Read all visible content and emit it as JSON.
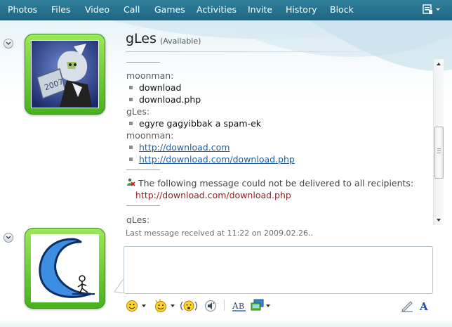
{
  "menu": {
    "items": [
      "Photos",
      "Files",
      "Video",
      "Call",
      "Games",
      "Activities",
      "Invite",
      "History",
      "Block"
    ]
  },
  "contact": {
    "name": "gLes",
    "status": "(Available)"
  },
  "conversation": {
    "messages": [
      {
        "sender": "moonman:",
        "lines": [
          "download",
          "download.php"
        ]
      },
      {
        "sender": "gLes:",
        "lines": [
          "egyre gagyibbak a spam-ek"
        ]
      },
      {
        "sender": "moonman:",
        "links": [
          "http://download.com",
          "http://download.com/download.php"
        ]
      }
    ],
    "error": {
      "text": "The following message could not be delivered to all recipients:",
      "url": "http://download.com/download.php"
    },
    "last_sender": "gLes:"
  },
  "last_message": "Last message received at 11:22 on 2009.02.26..",
  "icons": {
    "menu_more": "window-menu-icon",
    "error": "red-x-person-icon",
    "emoticon": "smiley-icon",
    "wink": "wink-icon",
    "nudge": "nudge-icon",
    "voice_clip": "voice-clip-icon",
    "font": "font-icon",
    "backgrounds": "backgrounds-icon",
    "handwriting": "handwriting-icon",
    "text_style": "text-style-icon"
  },
  "colors": {
    "menubar": "#2a7692",
    "link": "#1f5faa",
    "error_url": "#8b1f1f",
    "avatar_frame": "#5cc72c"
  }
}
